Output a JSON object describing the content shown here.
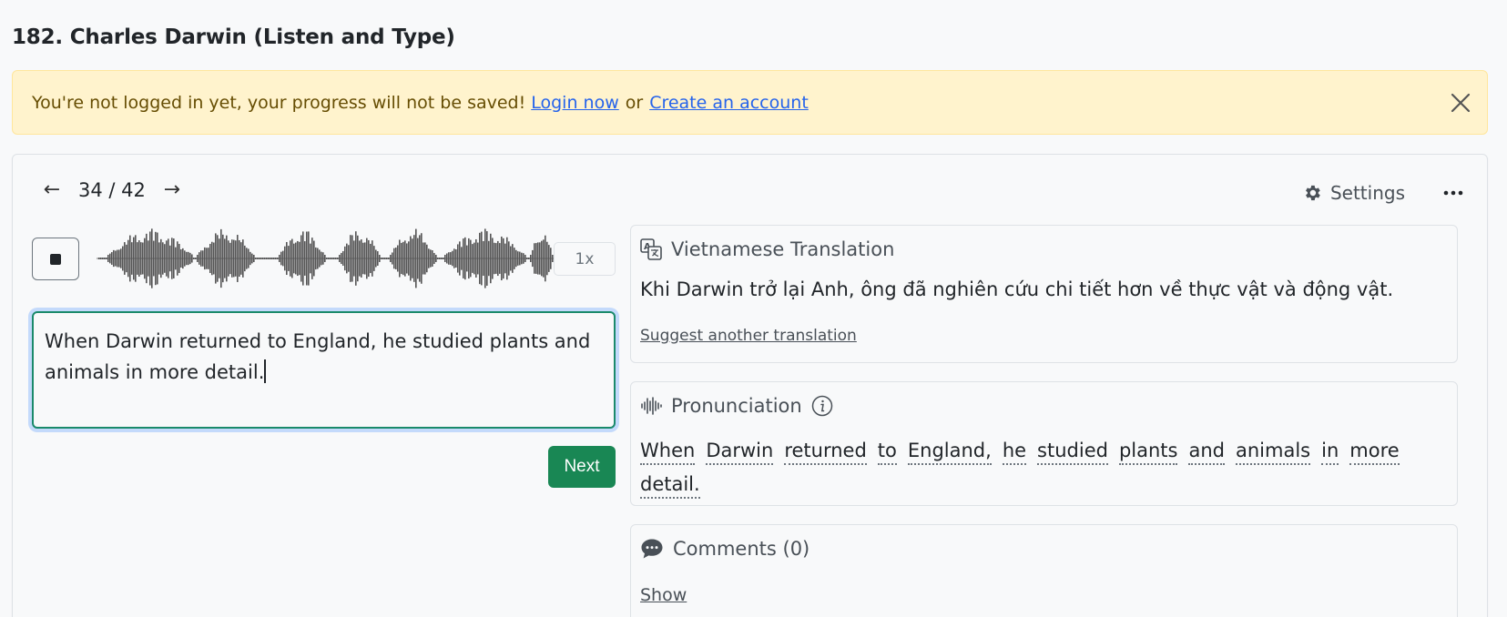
{
  "page": {
    "title": "182. Charles Darwin (Listen and Type)"
  },
  "alert": {
    "message": "You're not logged in yet, your progress will not be saved!",
    "login_link": "Login now",
    "separator": "or",
    "create_link": "Create an account"
  },
  "nav": {
    "counter": "34 / 42",
    "prev": "←",
    "next": "→"
  },
  "toolbar": {
    "settings_label": "Settings"
  },
  "player": {
    "speed_label": "1x"
  },
  "answer": {
    "value": "When Darwin returned to England, he studied plants and animals in more detail."
  },
  "actions": {
    "next_label": "Next"
  },
  "translation": {
    "heading": "Vietnamese Translation",
    "text": "Khi Darwin trở lại Anh, ông đã nghiên cứu chi tiết hơn về thực vật và động vật.",
    "suggest_link": "Suggest another translation"
  },
  "pronunciation": {
    "heading": "Pronunciation",
    "words": [
      "When",
      "Darwin",
      "returned",
      "to",
      "England,",
      "he",
      "studied",
      "plants",
      "and",
      "animals",
      "in",
      "more",
      "detail."
    ]
  },
  "comments": {
    "heading": "Comments (0)",
    "show_link": "Show"
  },
  "colors": {
    "accent": "#198754",
    "alert_bg": "#fff3cd",
    "link": "#2563eb"
  }
}
